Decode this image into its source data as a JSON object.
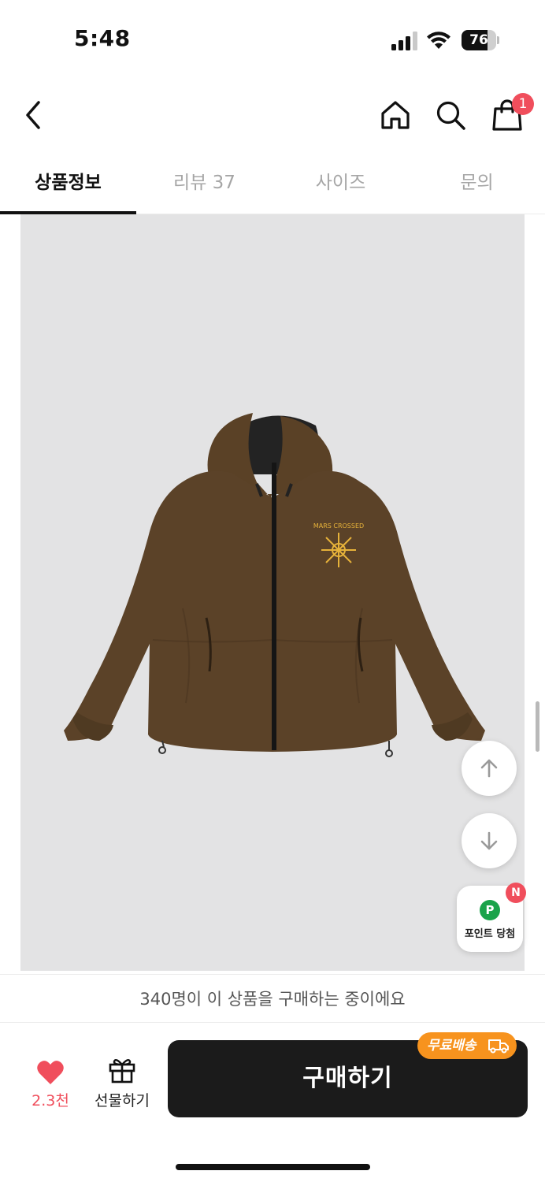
{
  "status_bar": {
    "time": "5:48",
    "battery": "76",
    "battery_level_percent": 76
  },
  "header": {
    "back_icon": "chevron-left-icon",
    "home_icon": "home-icon",
    "search_icon": "search-icon",
    "cart_icon": "shopping-bag-icon",
    "cart_badge": "1"
  },
  "tabs": [
    {
      "label": "상품정보",
      "active": true
    },
    {
      "label": "리뷰 37",
      "active": false
    },
    {
      "label": "사이즈",
      "active": false
    },
    {
      "label": "문의",
      "active": false
    }
  ],
  "product": {
    "image_alt": "brown hooded zip-up jacket",
    "logo_text": "MARS CROSSED"
  },
  "float_buttons": {
    "up_icon": "arrow-up-icon",
    "down_icon": "arrow-down-icon",
    "point_symbol": "P",
    "point_label": "포인트 당첨",
    "new_badge": "N"
  },
  "buyers_notice": "340명이 이 상품을 구매하는 중이에요",
  "bottom": {
    "like_count": "2.3천",
    "gift_label": "선물하기",
    "buy_label": "구매하기",
    "free_shipping": "무료배송"
  },
  "colors": {
    "accent_red": "#f04e5c",
    "free_shipping_orange": "#f7931e",
    "buy_button": "#1b1b1b",
    "jacket_brown": "#5a4126"
  }
}
